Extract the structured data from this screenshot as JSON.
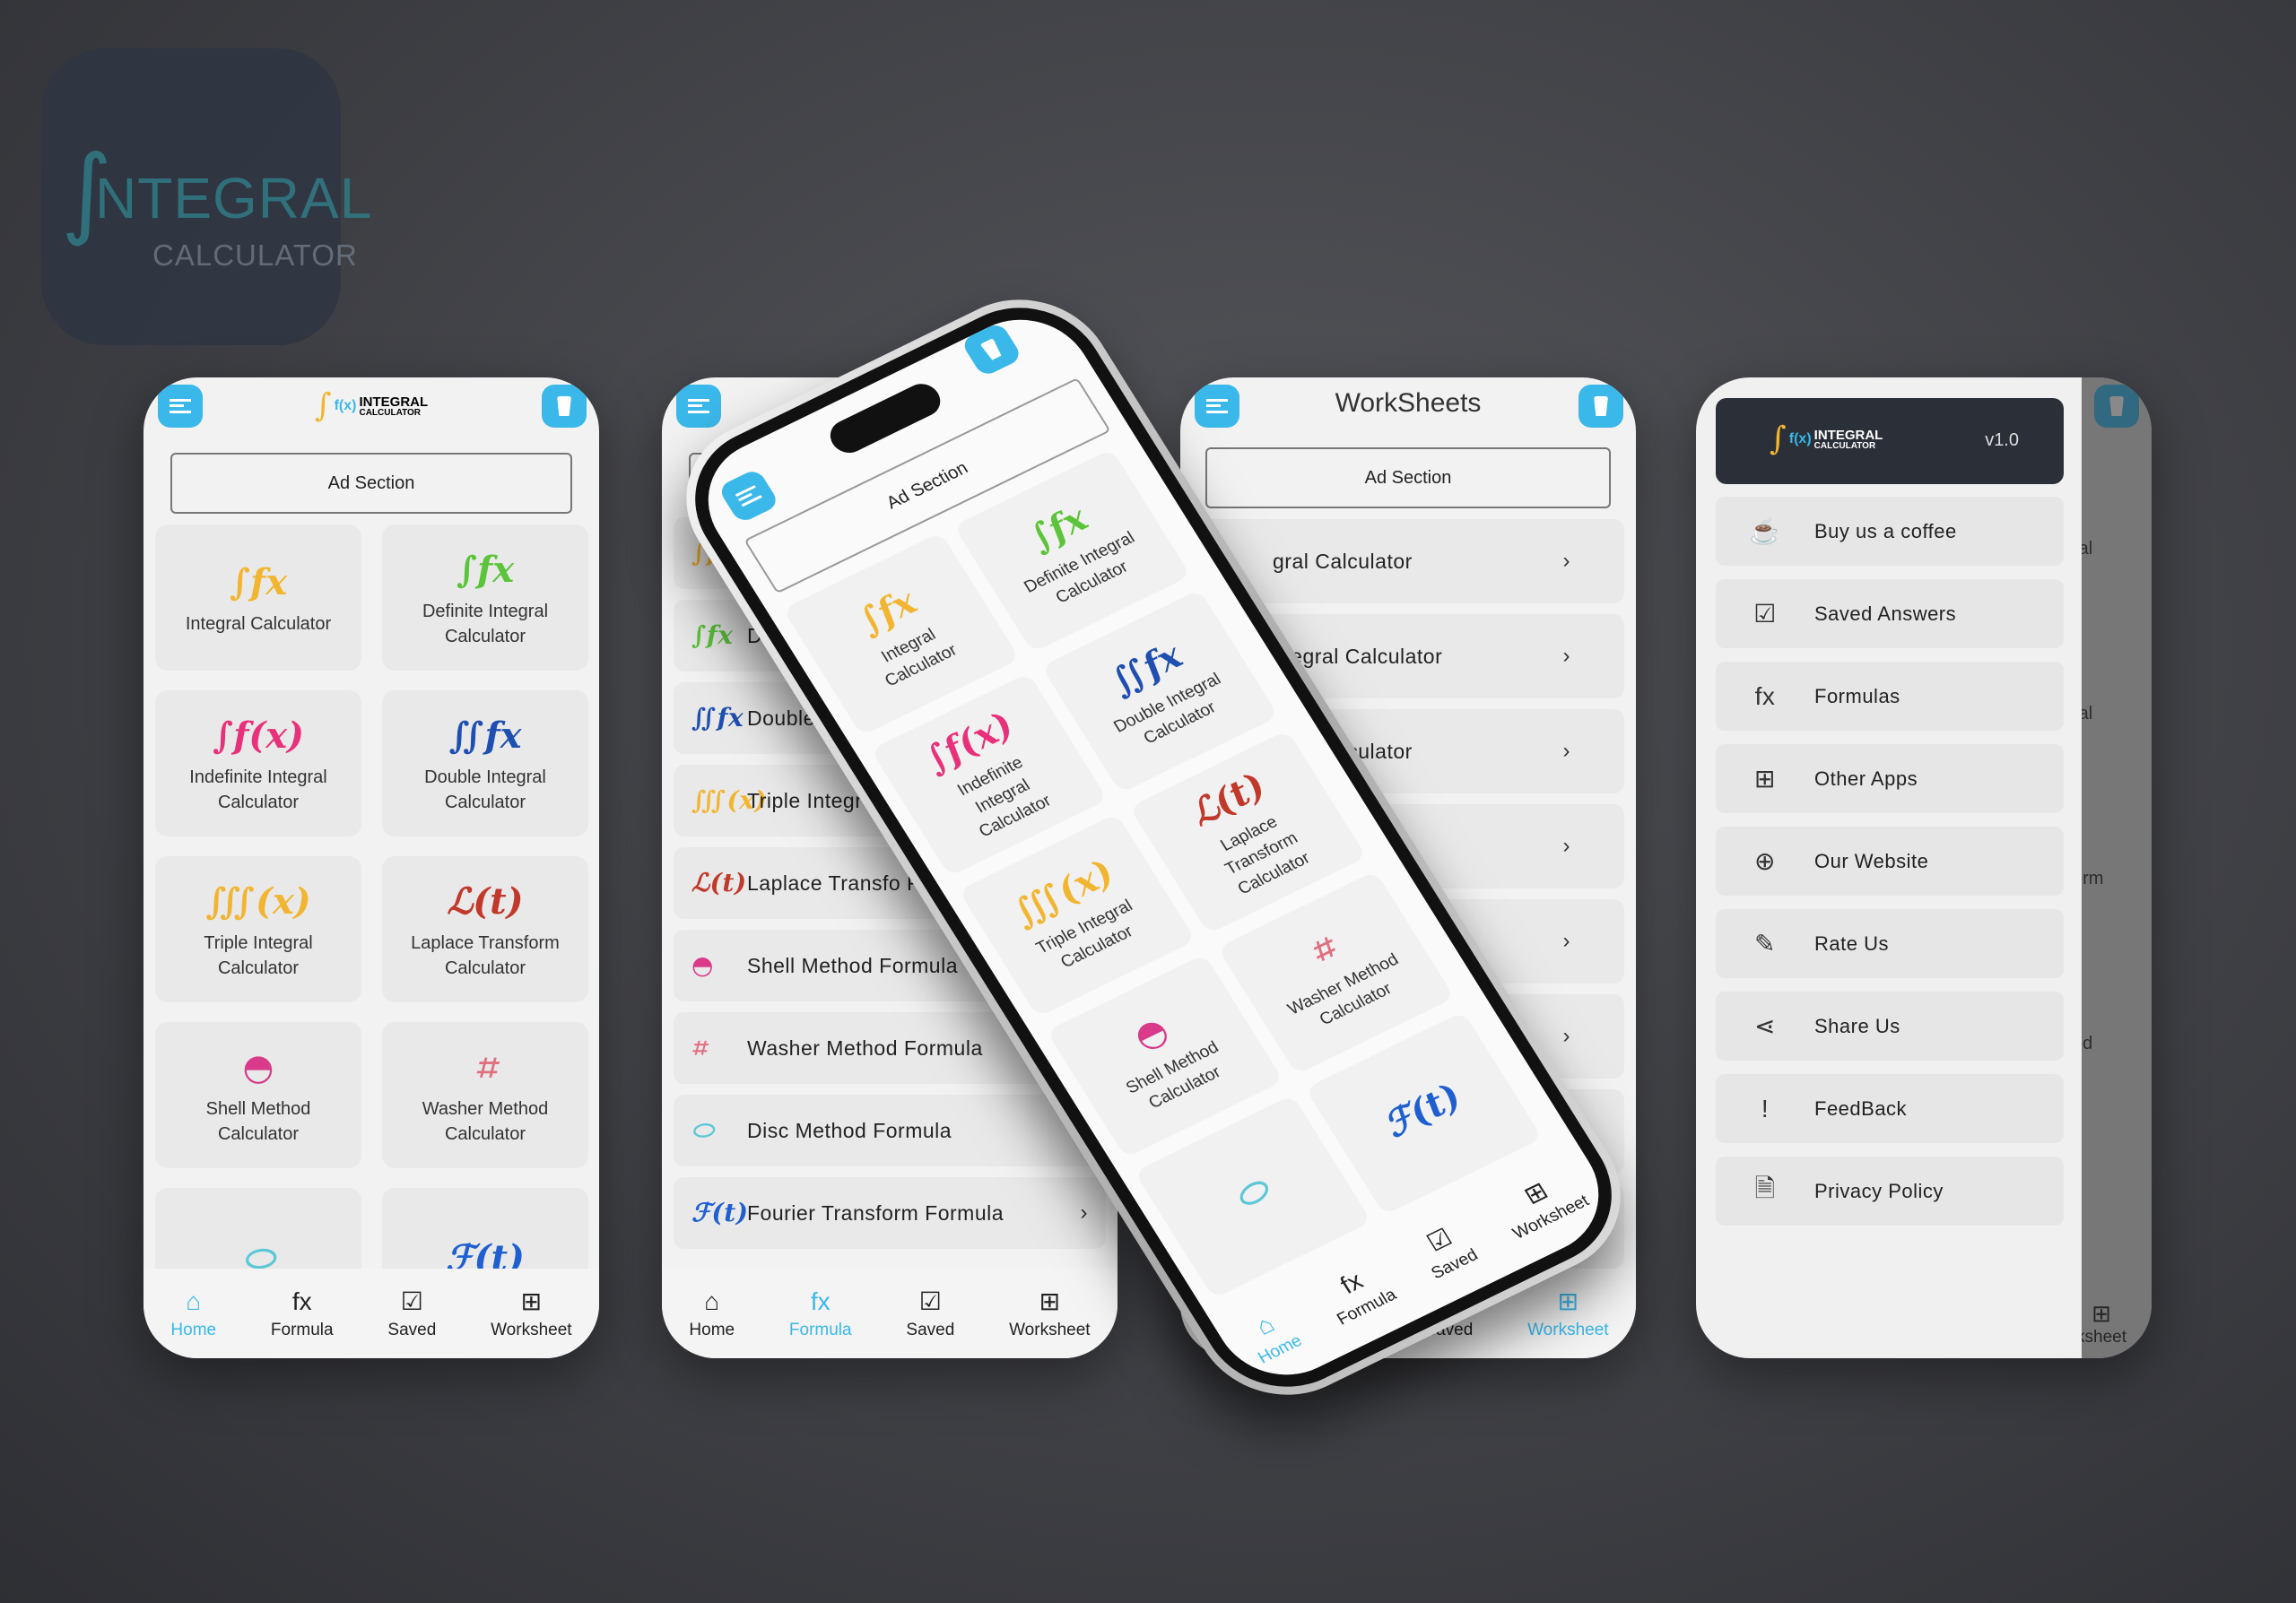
{
  "brand": {
    "logo_main": "INTEGRAL",
    "logo_sub": "CALCULATOR",
    "logo_fx": "f(x)",
    "app_icon_integral": "∫",
    "app_icon_text": "NTEGRAL",
    "app_icon_calc": "CALCULATOR"
  },
  "colors": {
    "accent": "#3ab8ea",
    "drawer_header": "#2b2f38",
    "card": "#e9e9e9"
  },
  "ad_label": "Ad Section",
  "home": {
    "cards": [
      {
        "glyph": "∫fx",
        "icon": "integral-icon",
        "color": "#f2b531",
        "label": "Integral Calculator"
      },
      {
        "glyph": "∫fx",
        "icon": "definite-integral-icon",
        "color": "#5cc43a",
        "label": "Definite Integral Calculator"
      },
      {
        "glyph": "∫f(x)",
        "icon": "indefinite-integral-icon",
        "color": "#e8317a",
        "label": "Indefinite Integral Calculator"
      },
      {
        "glyph": "∬fx",
        "icon": "double-integral-icon",
        "color": "#1f4fb0",
        "label": "Double Integral Calculator"
      },
      {
        "glyph": "∭(x)",
        "icon": "triple-integral-icon",
        "color": "#f2b531",
        "label": "Triple Integral Calculator"
      },
      {
        "glyph": "ℒ(t)",
        "icon": "laplace-icon",
        "color": "#c0392b",
        "label": "Laplace Transform Calculator"
      },
      {
        "glyph": "◓",
        "icon": "shell-icon",
        "color": "#d93a8a",
        "label": "Shell Method Calculator"
      },
      {
        "glyph": "⌗",
        "icon": "washer-icon",
        "color": "#e07080",
        "label": "Washer Method Calculator"
      },
      {
        "glyph": "⬭",
        "icon": "disc-icon",
        "color": "#5cc7d6",
        "label": ""
      },
      {
        "glyph": "ℱ(t)",
        "icon": "fourier-icon",
        "color": "#1f5fd0",
        "label": ""
      }
    ]
  },
  "nav": [
    {
      "label": "Home",
      "icon": "home-icon",
      "glyph": "⌂"
    },
    {
      "label": "Formula",
      "icon": "fx-icon",
      "glyph": "fx"
    },
    {
      "label": "Saved",
      "icon": "saved-icon",
      "glyph": "☑"
    },
    {
      "label": "Worksheet",
      "icon": "worksheet-icon",
      "glyph": "⊞"
    }
  ],
  "formula": {
    "items": [
      {
        "glyph": "∫fx",
        "icon": "integral-icon",
        "color": "#f2b531",
        "label": ""
      },
      {
        "glyph": "∫fx",
        "icon": "definite-integral-icon",
        "color": "#5cc43a",
        "label": "De For"
      },
      {
        "glyph": "∬fx",
        "icon": "double-integral-icon",
        "color": "#1f4fb0",
        "label": "Double"
      },
      {
        "glyph": "∭(x)",
        "icon": "triple-integral-icon",
        "color": "#f2b531",
        "label": "Triple Integr"
      },
      {
        "glyph": "ℒ(t)",
        "icon": "laplace-icon",
        "color": "#c0392b",
        "label": "Laplace Transfo Formula"
      },
      {
        "glyph": "◓",
        "icon": "shell-icon",
        "color": "#d93a8a",
        "label": "Shell Method Formula"
      },
      {
        "glyph": "⌗",
        "icon": "washer-icon",
        "color": "#e07080",
        "label": "Washer Method Formula"
      },
      {
        "glyph": "⬭",
        "icon": "disc-icon",
        "color": "#5cc7d6",
        "label": "Disc Method Formula"
      },
      {
        "glyph": "ℱ(t)",
        "icon": "fourier-icon",
        "color": "#1f5fd0",
        "label": "Fourier Transform Formula"
      }
    ]
  },
  "worksheets": {
    "title": "WorkSheets",
    "items": [
      "gral Calculator",
      "ntegral Calculator",
      "gral Calculator",
      "culator",
      "",
      "",
      "",
      ""
    ]
  },
  "drawer": {
    "version": "v1.0",
    "items": [
      {
        "label": "Buy us a coffee",
        "icon": "coffee-icon",
        "glyph": "☕"
      },
      {
        "label": "Saved Answers",
        "icon": "saved-answers-icon",
        "glyph": "☑"
      },
      {
        "label": "Formulas",
        "icon": "fx-icon",
        "glyph": "fx"
      },
      {
        "label": "Other Apps",
        "icon": "apps-icon",
        "glyph": "⊞"
      },
      {
        "label": "Our Website",
        "icon": "globe-icon",
        "glyph": "⊕"
      },
      {
        "label": "Rate Us",
        "icon": "rate-icon",
        "glyph": "✎"
      },
      {
        "label": "Share Us",
        "icon": "share-icon",
        "glyph": "⋖"
      },
      {
        "label": "FeedBack",
        "icon": "feedback-icon",
        "glyph": "!"
      },
      {
        "label": "Privacy Policy",
        "icon": "privacy-icon",
        "glyph": "🗎"
      }
    ],
    "behind_fragments": [
      "ral",
      "ral",
      "orm",
      "od"
    ],
    "behind_nav": "ksheet"
  }
}
